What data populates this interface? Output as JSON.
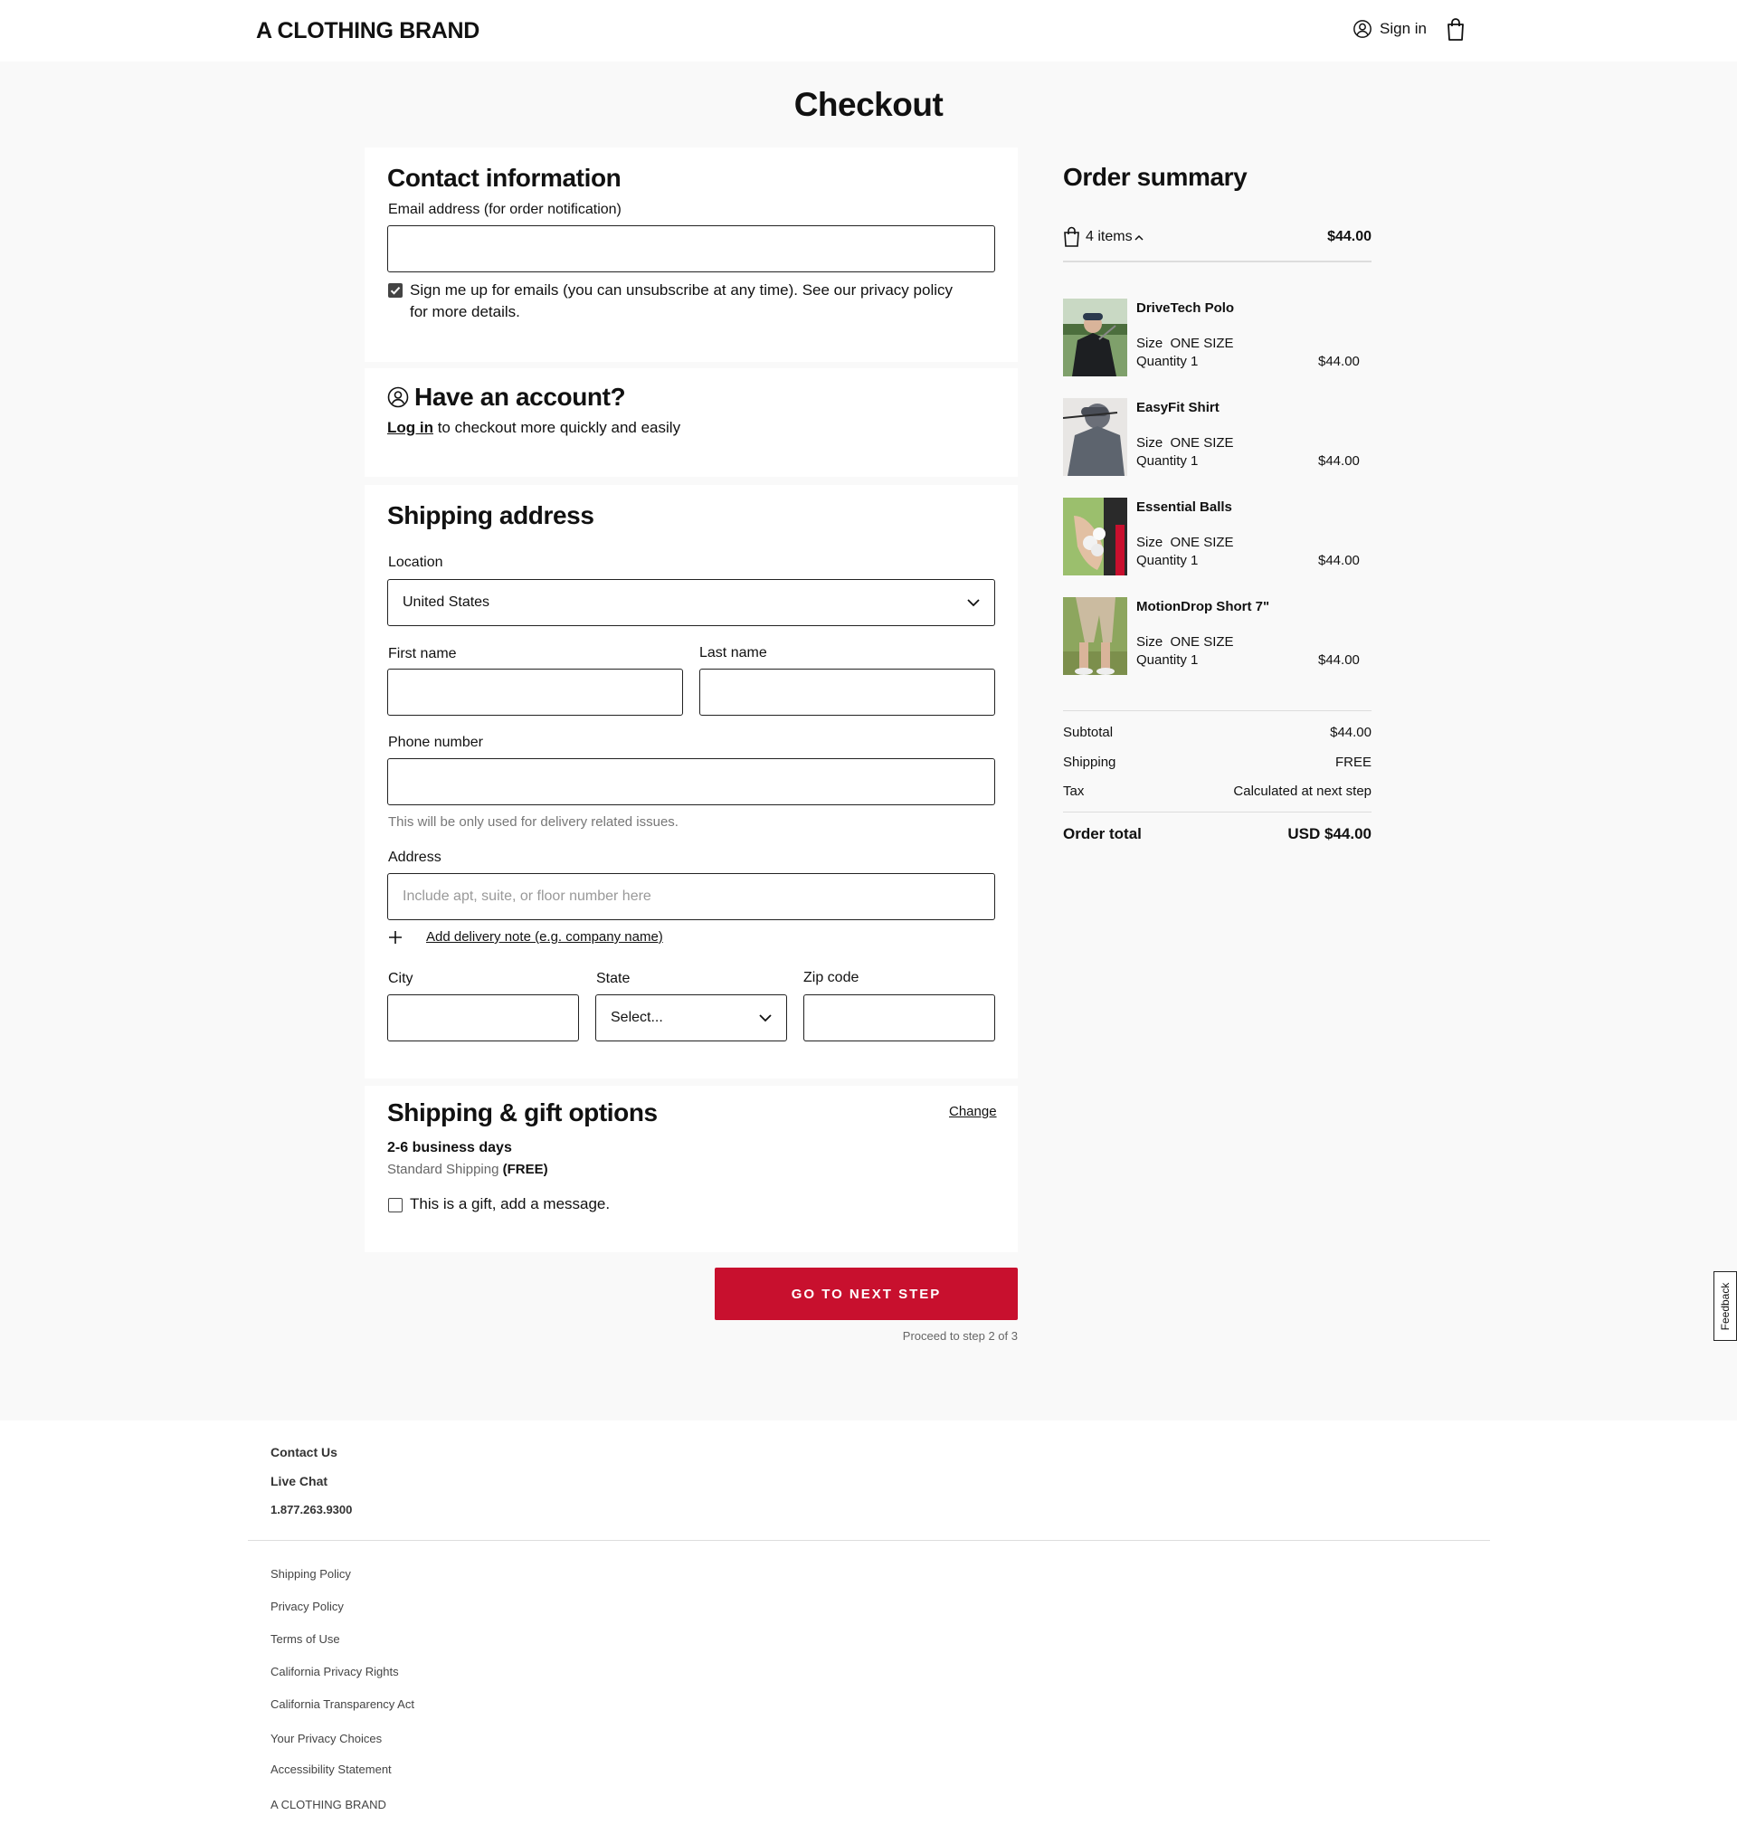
{
  "header": {
    "brand": "A CLOTHING BRAND",
    "signin_label": "Sign in"
  },
  "page": {
    "title": "Checkout"
  },
  "contact": {
    "title": "Contact information",
    "email_label": "Email address (for order notification)",
    "email_value": "",
    "newsletter_line1": "Sign me up for emails (you can unsubscribe at any time). See our privacy policy",
    "newsletter_line2": "for more details."
  },
  "account": {
    "title": "Have an account?",
    "login_link": "Log in",
    "login_text": " to checkout more quickly and easily"
  },
  "shipping": {
    "title": "Shipping address",
    "location_label": "Location",
    "location_value": "United States",
    "first_name_label": "First name",
    "last_name_label": "Last name",
    "phone_label": "Phone number",
    "phone_hint": "This will be only used for delivery related issues.",
    "address_label": "Address",
    "address_placeholder": "Include apt, suite, or floor number here",
    "delivery_note": "Add delivery note (e.g. company name)",
    "city_label": "City",
    "state_label": "State",
    "state_value": "Select...",
    "zip_label": "Zip code"
  },
  "options": {
    "title": "Shipping & gift options",
    "change_link": "Change",
    "days": "2-6 business days",
    "method": "Standard Shipping",
    "method_price": "(FREE)",
    "gift_label": "This is a gift, add a message."
  },
  "cta": {
    "label": "GO TO NEXT STEP",
    "sub": "Proceed to step 2 of 3"
  },
  "feedback": "Feedback",
  "summary": {
    "title": "Order summary",
    "items_count": "4 items",
    "items_total": "$44.00",
    "items": [
      {
        "name": "DriveTech Polo",
        "size_label": "Size",
        "size": "ONE SIZE",
        "qty": "Quantity 1",
        "price": "$44.00"
      },
      {
        "name": "EasyFit Shirt",
        "size_label": "Size",
        "size": "ONE SIZE",
        "qty": "Quantity 1",
        "price": "$44.00"
      },
      {
        "name": "Essential Balls",
        "size_label": "Size",
        "size": "ONE SIZE",
        "qty": "Quantity 1",
        "price": "$44.00"
      },
      {
        "name": "MotionDrop Short 7\"",
        "size_label": "Size",
        "size": "ONE SIZE",
        "qty": "Quantity 1",
        "price": "$44.00"
      }
    ],
    "subtotal_label": "Subtotal",
    "subtotal": "$44.00",
    "shipping_label": "Shipping",
    "shipping": "FREE",
    "tax_label": "Tax",
    "tax": "Calculated at next step",
    "total_label": "Order total",
    "total": "USD $44.00"
  },
  "footer": {
    "contact_us": "Contact Us",
    "live_chat": "Live Chat",
    "phone": "1.877.263.9300",
    "links": [
      "Shipping Policy",
      "Privacy Policy",
      "Terms of Use",
      "California Privacy Rights",
      "California Transparency Act",
      "Your Privacy Choices",
      "Accessibility Statement",
      "A CLOTHING BRAND"
    ]
  },
  "colors": {
    "accent": "#c8102e",
    "page_bg": "#f9f9f9"
  }
}
